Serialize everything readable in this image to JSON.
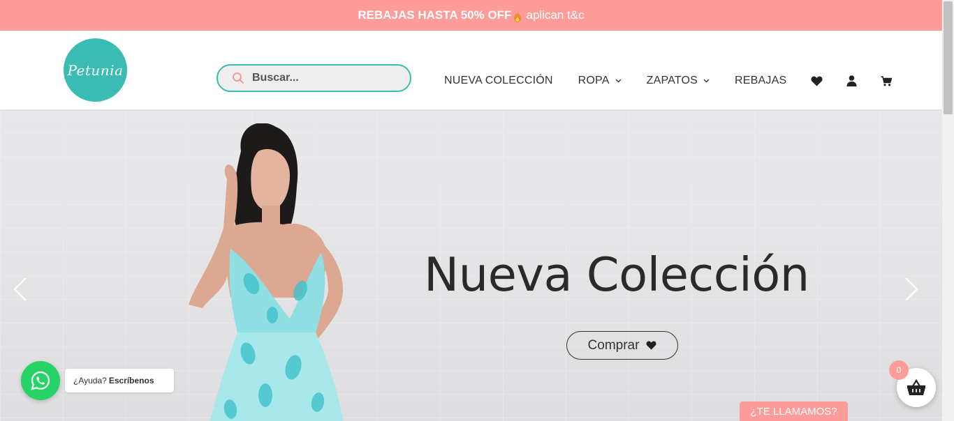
{
  "promo": {
    "bold_text": "REBAJAS HASTA 50% OFF",
    "text": "aplican t&c"
  },
  "brand": {
    "logo_text": "Petunia"
  },
  "search": {
    "placeholder": "Buscar..."
  },
  "nav": {
    "items": [
      {
        "label": "NUEVA COLECCIÓN",
        "has_dropdown": false
      },
      {
        "label": "ROPA",
        "has_dropdown": true
      },
      {
        "label": "ZAPATOS",
        "has_dropdown": true
      },
      {
        "label": "REBAJAS",
        "has_dropdown": false
      }
    ],
    "icons": [
      "heart-icon",
      "user-icon",
      "cart-icon"
    ]
  },
  "hero": {
    "title": "Nueva Colección",
    "cta_label": "Comprar"
  },
  "whatsapp": {
    "question": "¿Ayuda?",
    "action": "Escríbenos"
  },
  "callback": {
    "label": "¿TE LLAMAMOS?"
  },
  "cart": {
    "count": "0"
  },
  "colors": {
    "accent": "#3bbcb3",
    "promo": "#fd9c99",
    "whatsapp": "#25d366"
  }
}
